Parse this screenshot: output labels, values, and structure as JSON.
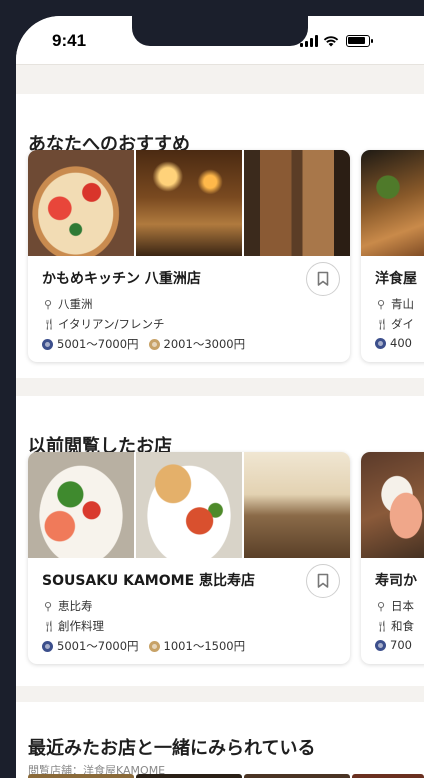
{
  "status_bar": {
    "time": "9:41"
  },
  "sections": {
    "recommended": {
      "title": "あなたへのおすすめ",
      "card": {
        "name": "かもめキッチン 八重洲店",
        "area": "八重洲",
        "genre": "イタリアン/フレンチ",
        "dinner_price": "5001〜7000円",
        "lunch_price": "2001〜3000円"
      },
      "partial": {
        "name": "洋食屋",
        "area": "青山",
        "genre": "ダイ",
        "price": "400"
      }
    },
    "history": {
      "title": "以前閲覧したお店",
      "card": {
        "name": "SOUSAKU KAMOME 恵比寿店",
        "area": "恵比寿",
        "genre": "創作料理",
        "dinner_price": "5001〜7000円",
        "lunch_price": "1001〜1500円"
      },
      "partial": {
        "name": "寿司か",
        "area": "日本",
        "genre": "和食",
        "price": "700"
      }
    },
    "related": {
      "title": "最近みたお店と一緒にみられている",
      "subtitle": "閲覧店舗：洋食屋KAMOME"
    }
  },
  "colors": {
    "dinner_dot": "#3c4f8c",
    "lunch_dot": "#c7a267",
    "frame": "#1b1f2c"
  },
  "icons": {
    "location": "location-pin-icon",
    "genre": "fork-knife-icon",
    "bookmark": "bookmark-icon"
  }
}
